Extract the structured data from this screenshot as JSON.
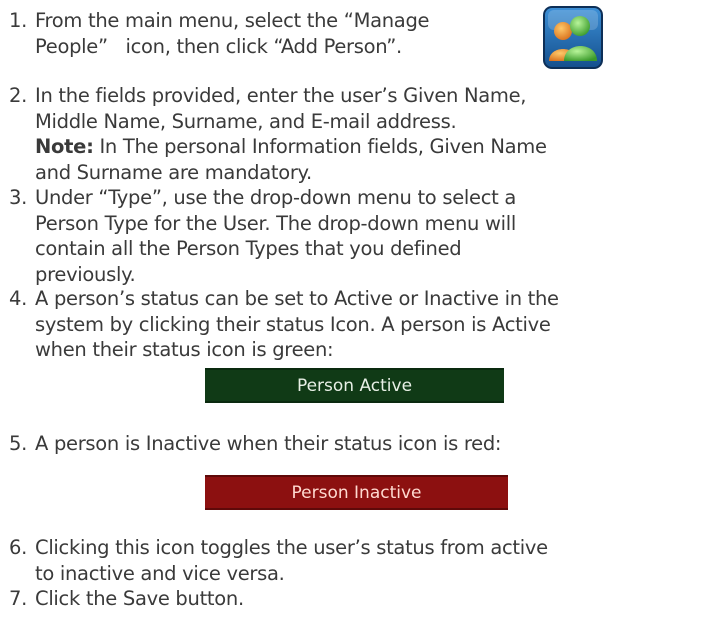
{
  "steps": [
    {
      "number": "1.",
      "lines": [
        "From the main menu, select the “Manage",
        "People”   icon, then click “Add Person”."
      ]
    },
    {
      "number": "2.",
      "lines": [
        "In the fields provided, enter the user’s Given Name,",
        "Middle Name, Surname, and E-mail address."
      ],
      "note_label": "Note:",
      "note_lines": [
        " In The personal Information fields, Given Name",
        "and Surname are mandatory."
      ]
    },
    {
      "number": "3.",
      "lines": [
        "Under “Type”, use the drop-down menu to select a",
        "Person Type for the User.  The drop-down menu will",
        "contain all the Person Types that you defined",
        "previously."
      ]
    },
    {
      "number": "4.",
      "lines": [
        "A person’s status can be set to Active or Inactive in the",
        "system by clicking their status Icon.  A person is Active",
        "when their status icon is green:"
      ]
    },
    {
      "number": "5.",
      "lines": [
        "A person is Inactive when their status icon is red:"
      ]
    },
    {
      "number": "6.",
      "lines": [
        "Clicking this icon toggles the user’s status from active",
        "to inactive and vice versa."
      ]
    },
    {
      "number": "7.",
      "lines": [
        "Click the Save button."
      ]
    }
  ],
  "status_active_label": "Person Active",
  "status_inactive_label": "Person Inactive",
  "icon": "manage-people-icon",
  "colors": {
    "active": "#103a16",
    "inactive": "#8c1010"
  }
}
